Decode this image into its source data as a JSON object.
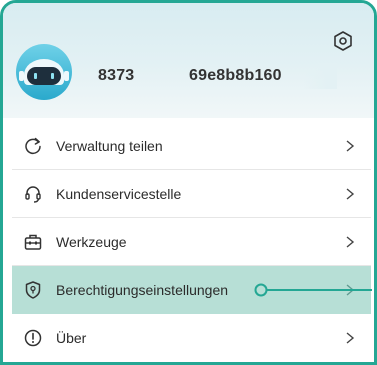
{
  "profile": {
    "user_id": "8373",
    "user_hash": "69e8b8b160"
  },
  "icons": {
    "settings": "settings-hexagon-icon",
    "chevron": "chevron-right-icon"
  },
  "menu": {
    "items": [
      {
        "label": "Verwaltung teilen",
        "icon": "share-management-icon"
      },
      {
        "label": "Kundenservicestelle",
        "icon": "headset-icon"
      },
      {
        "label": "Werkzeuge",
        "icon": "toolbox-icon"
      },
      {
        "label": "Berechtigungseinstellungen",
        "icon": "shield-permission-icon"
      },
      {
        "label": "Über",
        "icon": "info-circle-icon"
      }
    ]
  },
  "colors": {
    "accent": "#24a794",
    "highlight": "#b7dfd6"
  }
}
